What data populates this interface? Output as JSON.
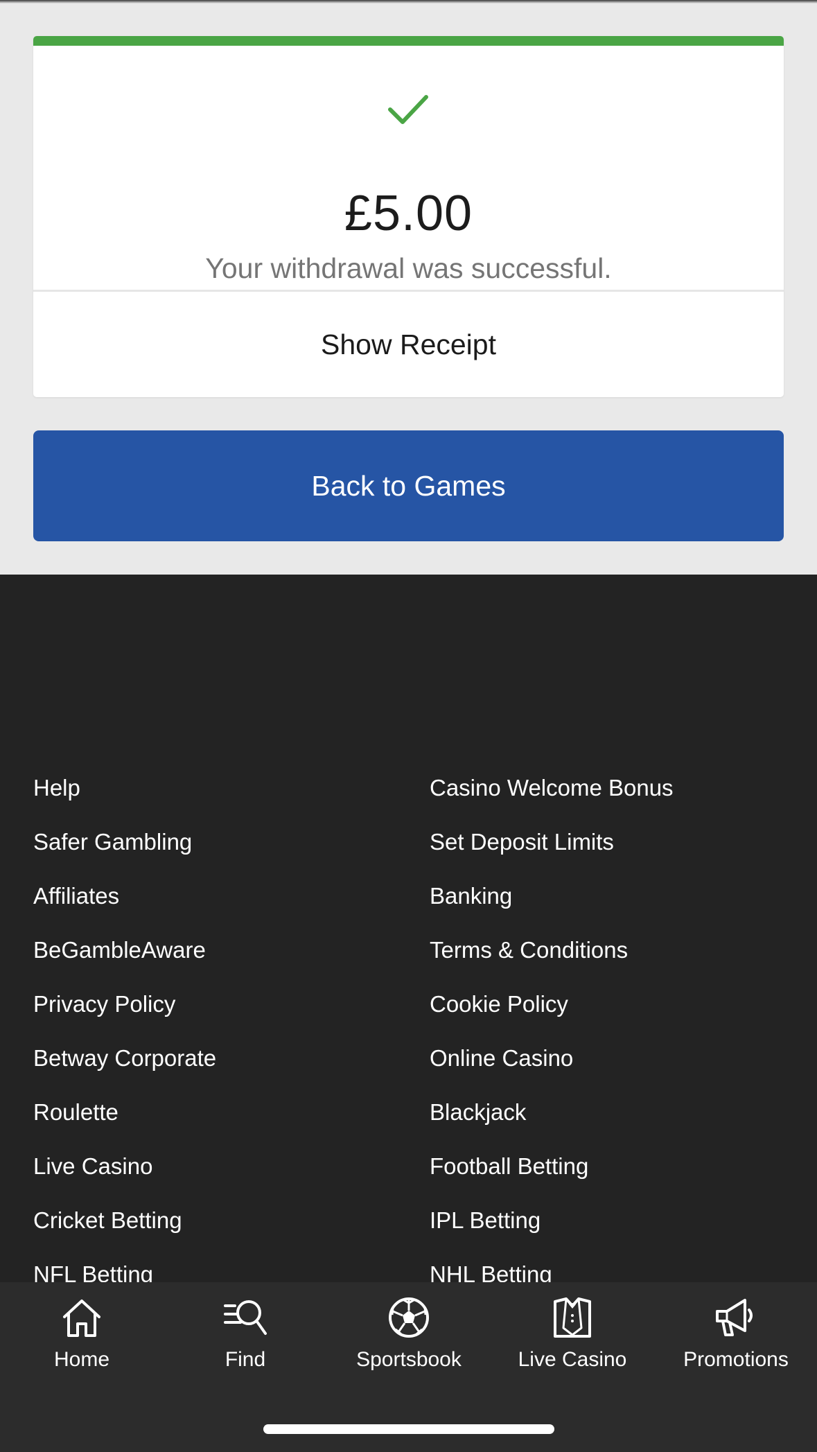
{
  "confirmation": {
    "amount": "£5.00",
    "message": "Your withdrawal was successful.",
    "show_receipt_label": "Show Receipt",
    "status_color": "#4aa545"
  },
  "back_button": {
    "label": "Back to Games",
    "color": "#2655a5"
  },
  "footer": {
    "left_links": [
      "Help",
      "Safer Gambling",
      "Affiliates",
      "BeGambleAware",
      "Privacy Policy",
      "Betway Corporate",
      "Roulette",
      "Live Casino",
      "Cricket Betting",
      "NFL Betting"
    ],
    "right_links": [
      "Casino Welcome Bonus",
      "Set Deposit Limits",
      "Banking",
      "Terms & Conditions",
      "Cookie Policy",
      "Online Casino",
      "Blackjack",
      "Football Betting",
      "IPL Betting",
      "NHL Betting"
    ]
  },
  "bottom_nav": {
    "items": [
      {
        "label": "Home",
        "icon": "home-icon"
      },
      {
        "label": "Find",
        "icon": "find-icon"
      },
      {
        "label": "Sportsbook",
        "icon": "football-icon"
      },
      {
        "label": "Live Casino",
        "icon": "live-casino-icon"
      },
      {
        "label": "Promotions",
        "icon": "megaphone-icon"
      }
    ]
  }
}
